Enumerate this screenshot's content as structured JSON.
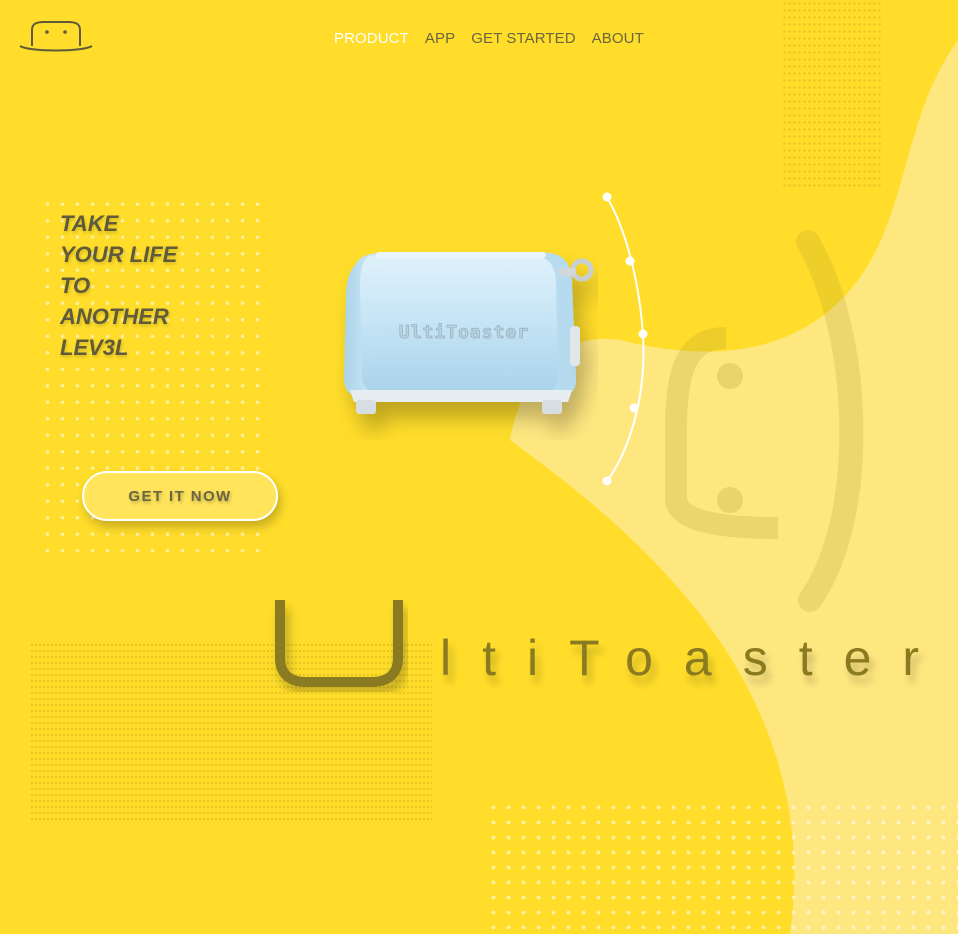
{
  "colors": {
    "background": "#FFDD2A",
    "nav_active": "#ffffff",
    "nav_text": "#6b6540",
    "headline_text": "#5f5a3a",
    "brand_text": "#8a7a20",
    "blob_light": "#FFE780"
  },
  "header": {
    "logo_icon": "hat-face-logo-icon",
    "nav": [
      {
        "label": "PRODUCT",
        "active": true
      },
      {
        "label": "APP",
        "active": false
      },
      {
        "label": "GET STARTED",
        "active": false
      },
      {
        "label": "ABOUT",
        "active": false
      }
    ]
  },
  "hero": {
    "tagline": [
      "TAKE",
      "YOUR LIFE",
      "TO",
      "ANOTHER",
      "LEV3L"
    ],
    "cta_label": "GET IT NOW",
    "product_label": "UltiToaster",
    "slider_points": 5,
    "slider_icon": "vertical-dot-slider-icon"
  },
  "brand": {
    "first_letter": "U",
    "rest": "ltiToaster"
  }
}
